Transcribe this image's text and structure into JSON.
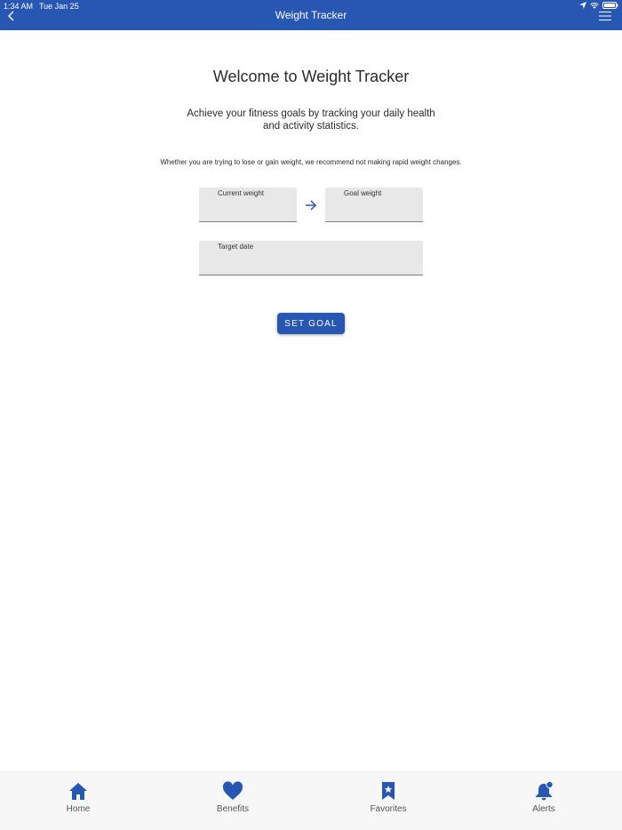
{
  "status_bar": {
    "time": "1:34 AM",
    "date": "Tue Jan 25"
  },
  "header": {
    "title": "Weight Tracker"
  },
  "main": {
    "welcome": "Welcome to Weight Tracker",
    "subtitle": "Achieve your fitness goals by tracking your daily health and activity statistics.",
    "note": "Whether you are trying to lose or gain weight, we recommend not making rapid weight changes.",
    "fields": {
      "current_weight": {
        "label": "Current weight",
        "value": ""
      },
      "goal_weight": {
        "label": "Goal weight",
        "value": ""
      },
      "target_date": {
        "label": "Target date",
        "value": ""
      }
    },
    "set_goal_label": "SET GOAL"
  },
  "tabs": [
    {
      "label": "Home",
      "icon": "home-icon"
    },
    {
      "label": "Benefits",
      "icon": "heart-icon"
    },
    {
      "label": "Favorites",
      "icon": "bookmark-star-icon"
    },
    {
      "label": "Alerts",
      "icon": "bell-icon"
    }
  ],
  "colors": {
    "primary": "#2756b3",
    "field_bg": "#e8e8e8",
    "tabbar_bg": "#f7f7f7"
  }
}
